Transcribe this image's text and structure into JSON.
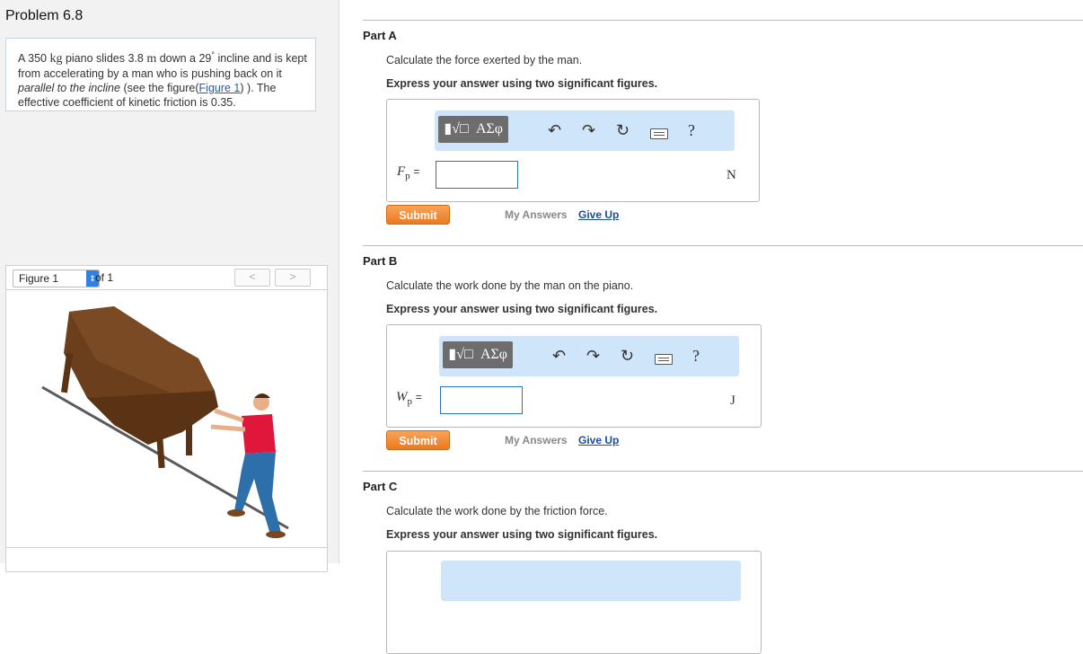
{
  "problem": {
    "title": "Problem 6.8",
    "text_parts": {
      "mass": "A 350",
      "kg": "kg",
      "mid": "piano slides 3.8",
      "m": "m",
      "after": "down a 29",
      "deg": "°",
      "rest": "incline and is kept from accelerating by a man who is pushing back on it",
      "italic": "parallel to the incline",
      "see": "(see the figure(",
      "figlink": "Figure 1",
      "close": ") ). The effective coefficient of kinetic friction is 0.35."
    }
  },
  "figure": {
    "select_value": "Figure 1",
    "of": "of 1",
    "prev": "<",
    "next": ">"
  },
  "toolbar": {
    "templates": "▮√□",
    "greek": "ΑΣφ",
    "undo": "↶",
    "redo": "↷",
    "reset": "↻",
    "help": "?"
  },
  "parts": [
    {
      "heading": "Part A",
      "question": "Calculate the force exerted by the man.",
      "instruction": "Express your answer using two significant figures.",
      "var": "F",
      "sub": "p",
      "eq": "=",
      "value": "",
      "unit": "N",
      "submit": "Submit",
      "my_answers": "My Answers",
      "give_up": "Give Up"
    },
    {
      "heading": "Part B",
      "question": "Calculate the work done by the man on the piano.",
      "instruction": "Express your answer using two significant figures.",
      "var": "W",
      "sub": "p",
      "eq": "=",
      "value": "",
      "unit": "J",
      "submit": "Submit",
      "my_answers": "My Answers",
      "give_up": "Give Up"
    },
    {
      "heading": "Part C",
      "question": "Calculate the work done by the friction force.",
      "instruction": "Express your answer using two significant figures."
    }
  ]
}
